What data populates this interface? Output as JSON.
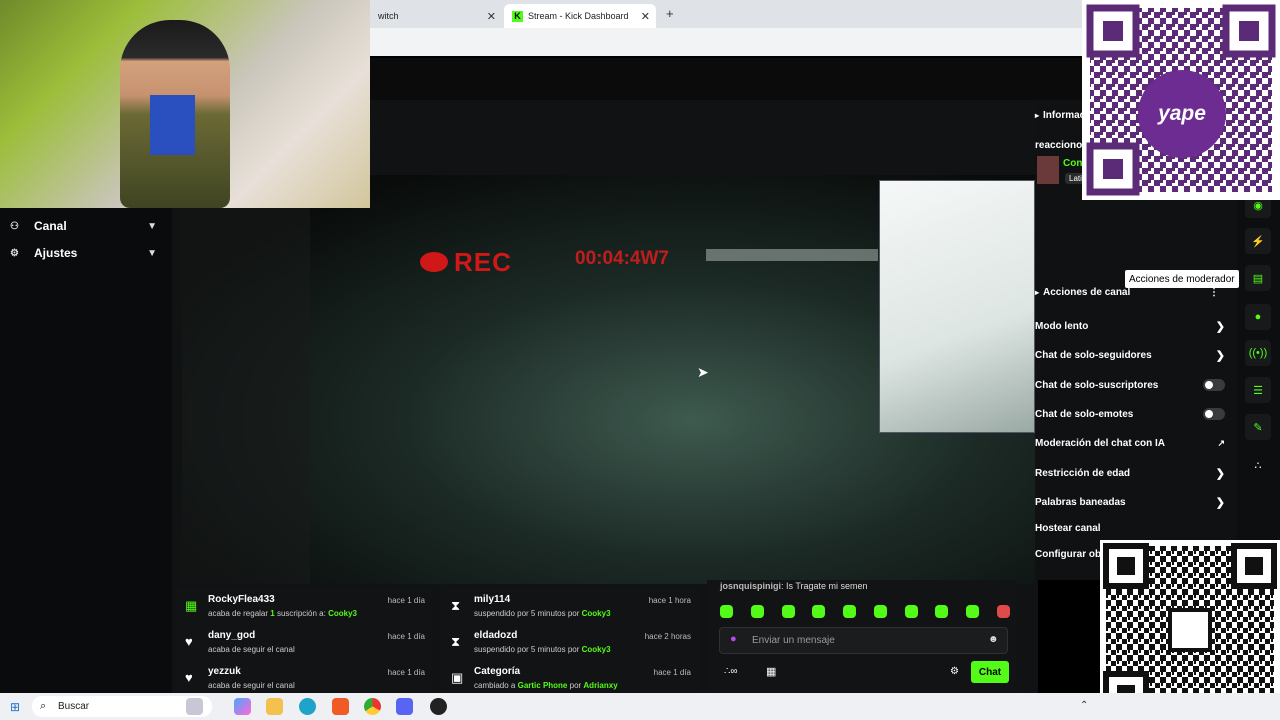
{
  "browser": {
    "tabs": [
      {
        "label": "witch"
      },
      {
        "label": "Stream - Kick Dashboard",
        "active": true
      }
    ],
    "new_tab_icon": "plus-icon",
    "kick_glyph": "K"
  },
  "left_nav": {
    "items": [
      {
        "label": "Canal",
        "icon": "channel-icon"
      },
      {
        "label": "Ajustes",
        "icon": "gear-icon"
      }
    ]
  },
  "video": {
    "rec_label": "REC",
    "timecode": "00:04:4W7"
  },
  "right_panel": {
    "info_header": "Informac",
    "stream_title": "reacciono",
    "stream_category": "Con",
    "stream_language": "Lati",
    "tooltip": "Acciones de moderador",
    "actions_header": "Acciones de canal",
    "actions": [
      {
        "label": "Modo lento",
        "control": "chevron"
      },
      {
        "label": "Chat de solo-seguidores",
        "control": "chevron"
      },
      {
        "label": "Chat de solo-suscriptores",
        "control": "toggle",
        "on": false
      },
      {
        "label": "Chat de solo-emotes",
        "control": "toggle",
        "on": false
      },
      {
        "label": "Moderación del chat con IA",
        "control": "external"
      },
      {
        "label": "Restricción de edad",
        "control": "chevron"
      },
      {
        "label": "Palabras baneadas",
        "control": "chevron"
      },
      {
        "label": "Hostear canal",
        "control": "none"
      },
      {
        "label": "Configurar obje",
        "control": "none"
      }
    ]
  },
  "sidebar_icons": [
    "camera-icon",
    "lightning-icon",
    "note-icon",
    "chat-icon",
    "broadcast-icon",
    "layout-icon",
    "wrench-icon",
    "dots-icon"
  ],
  "feed_left": [
    {
      "user": "RockyFlea433",
      "time": "hace 1 día",
      "text_pre": "acaba de regalar ",
      "highlight1": "1",
      "text_mid": " suscripción a: ",
      "highlight2": "Cooky3",
      "icon": "gift-icon"
    },
    {
      "user": "dany_god",
      "time": "hace 1 día",
      "text": "acaba de seguir el canal",
      "icon": "heart-icon"
    },
    {
      "user": "yezzuk",
      "time": "hace 1 día",
      "text": "acaba de seguir el canal",
      "icon": "heart-icon"
    }
  ],
  "feed_mid": [
    {
      "user": "mily114",
      "time": "hace 1 hora",
      "text": "suspendido por 5 minutos por ",
      "by": "Cooky3",
      "icon": "hourglass-icon"
    },
    {
      "user": "eldadozd",
      "time": "hace 2 horas",
      "text": "suspendido por 5 minutos por ",
      "by": "Cooky3",
      "icon": "hourglass-icon"
    },
    {
      "user": "Categoría",
      "time": "hace 1 día",
      "text": "cambiado a ",
      "by": "Gartic Phone",
      "text2": " por ",
      "by2": "Adrianxy",
      "icon": "category-icon"
    }
  ],
  "chat": {
    "last_user": "josnquispinigi",
    "last_message": ": Is Tragate mi semen",
    "placeholder": "Enviar un mensaje",
    "send_label": "Chat"
  },
  "qr": {
    "yape_label": "yape"
  },
  "taskbar": {
    "search_label": "Buscar"
  },
  "colors": {
    "accent": "#53fc18",
    "background": "#000000",
    "rec_red": "#d01818"
  }
}
